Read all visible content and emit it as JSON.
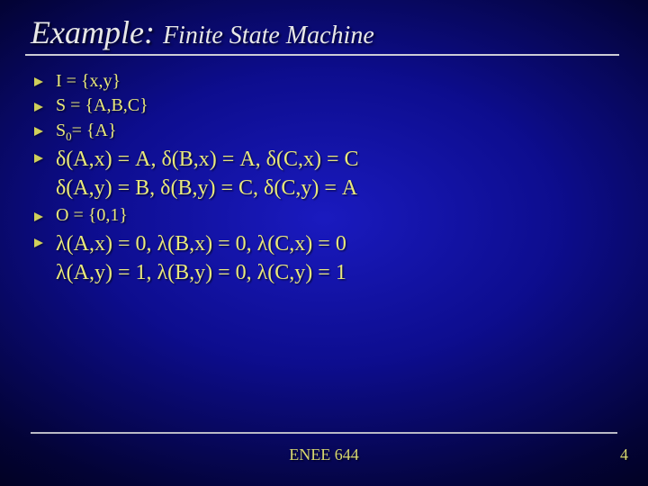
{
  "title": {
    "main": "Example:",
    "sub": "Finite State Machine"
  },
  "bullets": {
    "b0": "I = {x,y}",
    "b1": "S = {A,B,C}",
    "b2_pre": "S",
    "b2_sub": "0",
    "b2_post": "= {A}",
    "b3_l1": "δ(A,x) = A, δ(B,x) = A, δ(C,x) = C",
    "b3_l2": "δ(A,y) = B, δ(B,y) = C, δ(C,y) = A",
    "b4": "O = {0,1}",
    "b5_l1": "λ(A,x) = 0, λ(B,x) = 0, λ(C,x) = 0",
    "b5_l2": "λ(A,y) = 1, λ(B,y) = 0, λ(C,y) = 1"
  },
  "footer": {
    "center": "ENEE 644",
    "page": "4"
  }
}
